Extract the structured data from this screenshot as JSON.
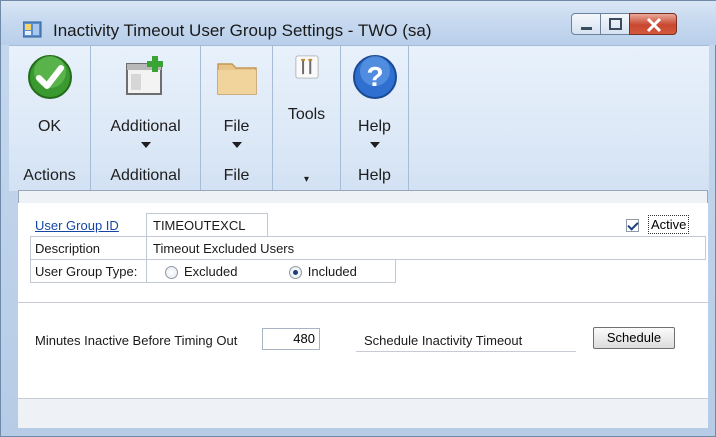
{
  "window": {
    "title": "Inactivity Timeout User Group Settings  -  TWO (sa)"
  },
  "ribbon": {
    "groups": [
      {
        "button_label": "OK",
        "group_label": "Actions",
        "icon": "ok-check-icon"
      },
      {
        "button_label": "Additional",
        "group_label": "Additional",
        "icon": "additional-window-plus-icon"
      },
      {
        "button_label": "File",
        "group_label": "File",
        "icon": "folder-icon"
      },
      {
        "button_label": "Tools",
        "group_label": "",
        "icon": "tools-icon"
      },
      {
        "button_label": "Help",
        "group_label": "Help",
        "icon": "help-question-icon"
      }
    ]
  },
  "form": {
    "user_group_id_label": "User Group ID",
    "user_group_id_value": "TIMEOUTEXCL",
    "description_label": "Description",
    "description_value": "Timeout Excluded Users",
    "group_type_label": "User Group Type:",
    "group_type_options": [
      "Excluded",
      "Included"
    ],
    "group_type_selected": "Included",
    "active_label": "Active",
    "active_checked": true,
    "minutes_label": "Minutes Inactive Before Timing Out",
    "minutes_value": "480",
    "schedule_label": "Schedule Inactivity Timeout",
    "schedule_button": "Schedule"
  },
  "colors": {
    "link": "#1747a6",
    "ribbon_bg": "#dde9f7",
    "close_button": "#c9472f"
  }
}
